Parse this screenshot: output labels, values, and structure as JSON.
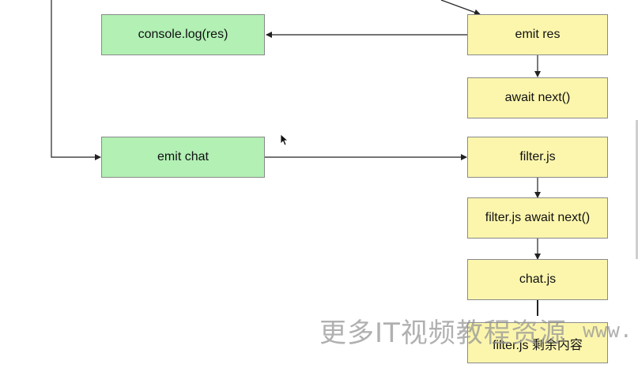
{
  "nodes": {
    "console_log": "console.log(res)",
    "emit_res": "emit res",
    "await_next": "await next()",
    "emit_chat": "emit chat",
    "filter_js": "filter.js",
    "filter_await_next": "filter.js await next()",
    "chat_js": "chat.js",
    "filter_rest": "filter.js 剩余内容"
  },
  "colors": {
    "green": "#b2f0b4",
    "yellow": "#fcf6ad",
    "line": "#222222"
  },
  "watermark": {
    "text": "更多IT视频教程资源",
    "url": "www."
  }
}
